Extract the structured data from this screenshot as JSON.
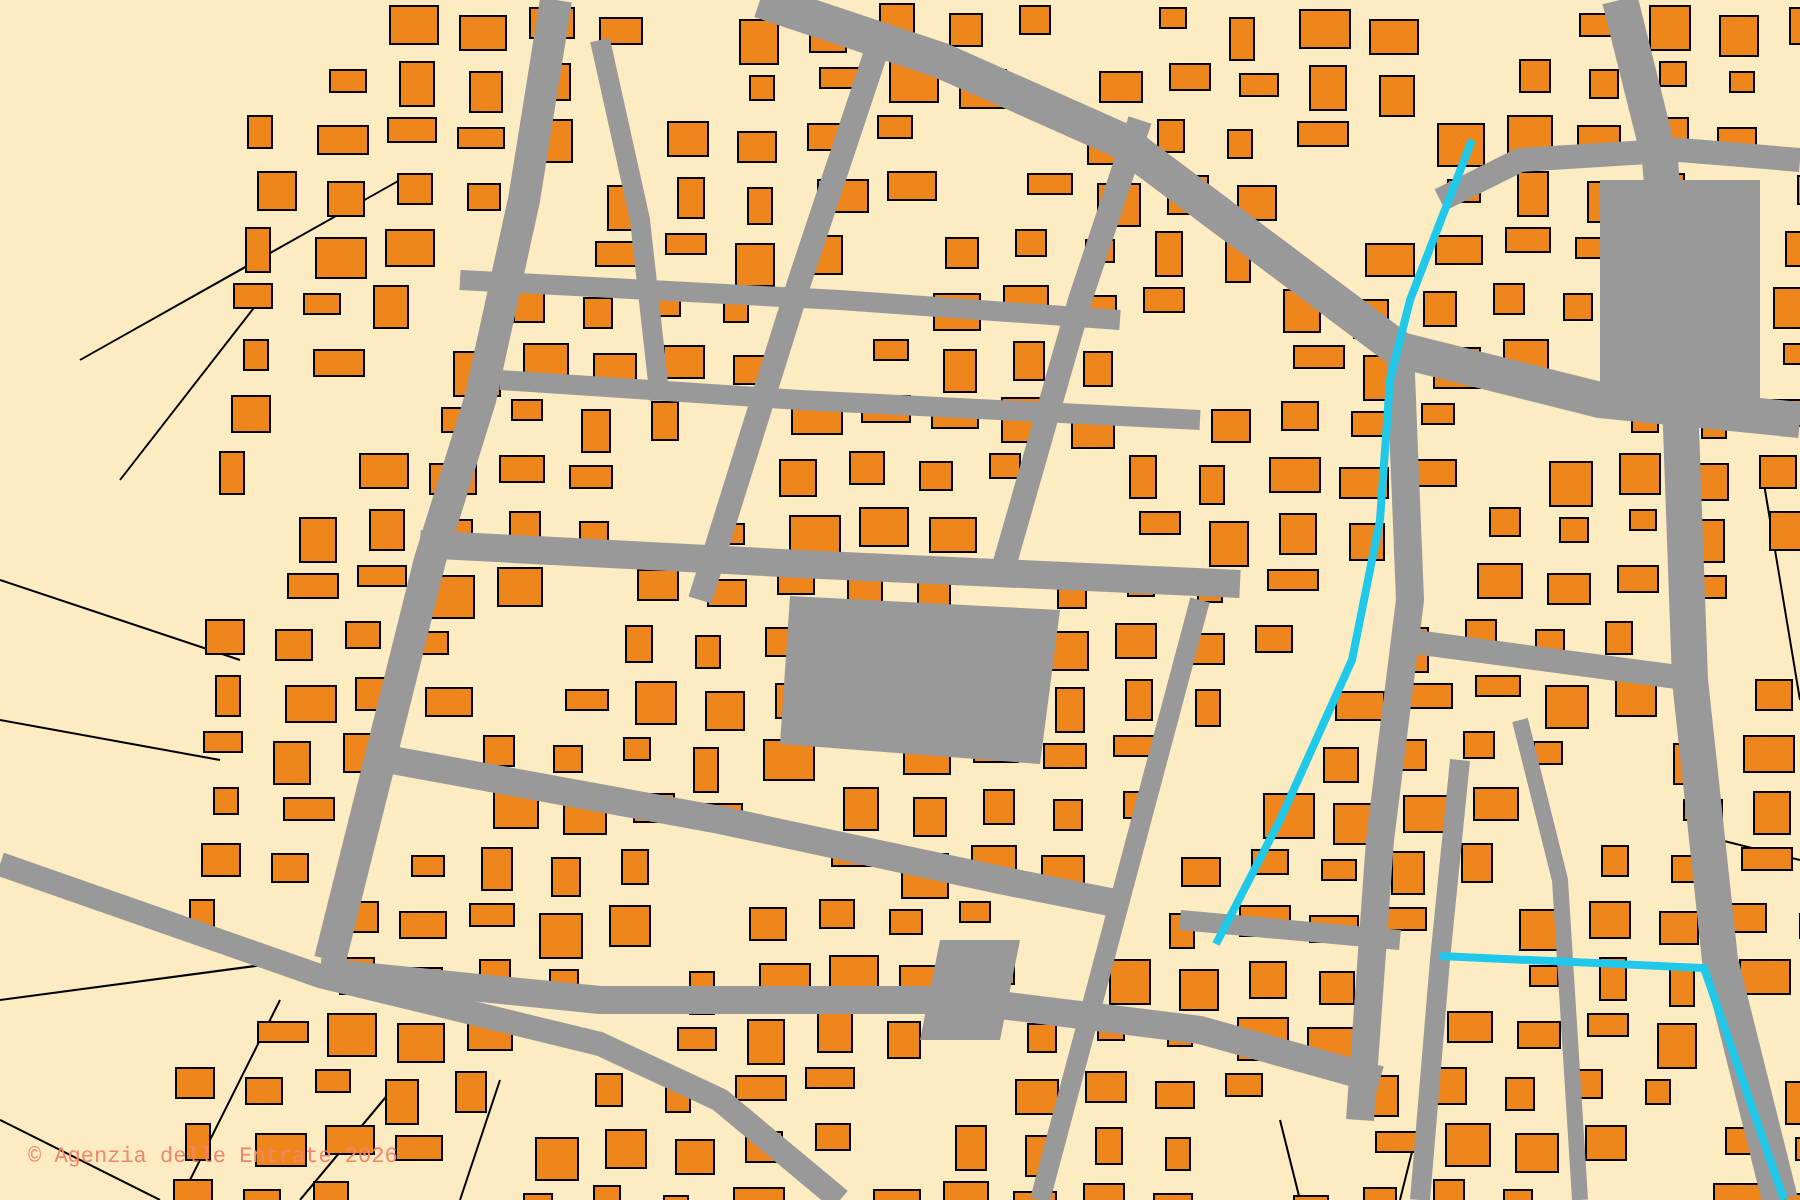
{
  "map": {
    "attribution": "© Agenzia delle Entrate 2026"
  }
}
